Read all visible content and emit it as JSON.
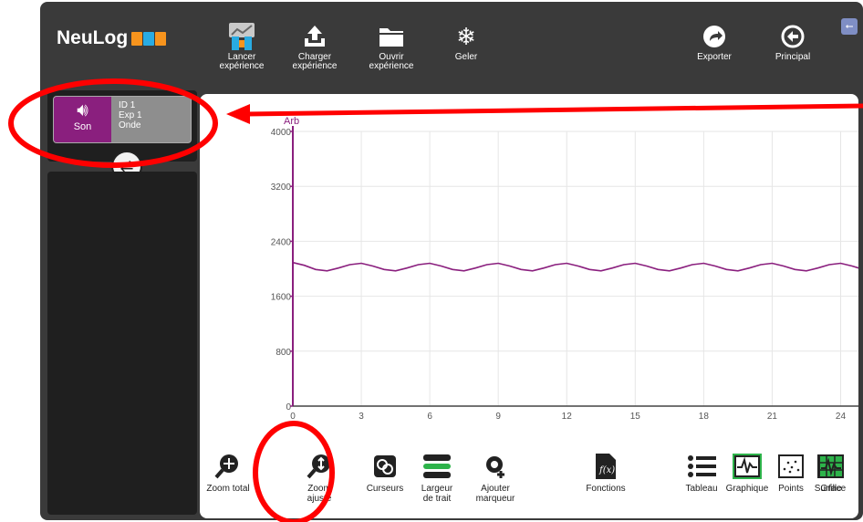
{
  "app": {
    "logo_text": "NeuLog",
    "logo_colors": [
      "#f7941d",
      "#29abe2",
      "#f7941d"
    ]
  },
  "toolbar_top": {
    "run": "Lancer expérience",
    "load": "Charger expérience",
    "open": "Ouvrir expérience",
    "freeze": "Geler",
    "export": "Exporter",
    "main": "Principal"
  },
  "sensor": {
    "name": "Son",
    "id": "ID 1",
    "exp": "Exp 1",
    "mode": "Onde",
    "color": "#8a1f7e"
  },
  "chart_data": {
    "type": "line",
    "ylabel": "Arb",
    "xlabel": "",
    "xlim": [
      0,
      25.5
    ],
    "ylim": [
      0,
      4000
    ],
    "x_ticks": [
      "0",
      "3",
      "6",
      "9",
      "12",
      "15",
      "18",
      "21",
      "24"
    ],
    "y_ticks": [
      "0",
      "800",
      "1600",
      "2400",
      "3200",
      "4000"
    ],
    "grid": true,
    "series": [
      {
        "color": "#8a1f7e",
        "x": [
          0,
          0.5,
          1.0,
          1.5,
          2.0,
          2.5,
          3.0,
          3.5,
          4.0,
          4.5,
          5.0,
          5.5,
          6.0,
          6.5,
          7.0,
          7.5,
          8.0,
          8.5,
          9.0,
          9.5,
          10.0,
          10.5,
          11.0,
          11.5,
          12.0,
          12.5,
          13.0,
          13.5,
          14.0,
          14.5,
          15.0,
          15.5,
          16.0,
          16.5,
          17.0,
          17.5,
          18.0,
          18.5,
          19.0,
          19.5,
          20.0,
          20.5,
          21.0,
          21.5,
          22.0,
          22.5,
          23.0,
          23.5,
          24.0,
          24.5,
          25.0,
          25.5
        ],
        "values": [
          2090,
          2050,
          1990,
          1970,
          2010,
          2060,
          2080,
          2040,
          1990,
          1970,
          2010,
          2060,
          2080,
          2040,
          1990,
          1970,
          2010,
          2060,
          2080,
          2040,
          1990,
          1970,
          2010,
          2060,
          2080,
          2040,
          1990,
          1970,
          2010,
          2060,
          2080,
          2040,
          1990,
          1970,
          2010,
          2060,
          2080,
          2040,
          1990,
          1970,
          2010,
          2060,
          2080,
          2040,
          1990,
          1970,
          2010,
          2060,
          2080,
          2040,
          1990,
          2060
        ]
      }
    ]
  },
  "toolbar_bottom": {
    "zoom_total": "Zoom total",
    "zoom_fit_1": "Zoom",
    "zoom_fit_2": "ajusté",
    "cursors": "Curseurs",
    "line_width_1": "Largeur",
    "line_width_2": "de trait",
    "add_marker_1": "Ajouter",
    "add_marker_2": "marqueur",
    "functions": "Fonctions",
    "table": "Tableau",
    "graph": "Graphique",
    "points": "Points",
    "surface": "Surface",
    "grid": "Grille"
  },
  "annotation_color": "#ff0000"
}
